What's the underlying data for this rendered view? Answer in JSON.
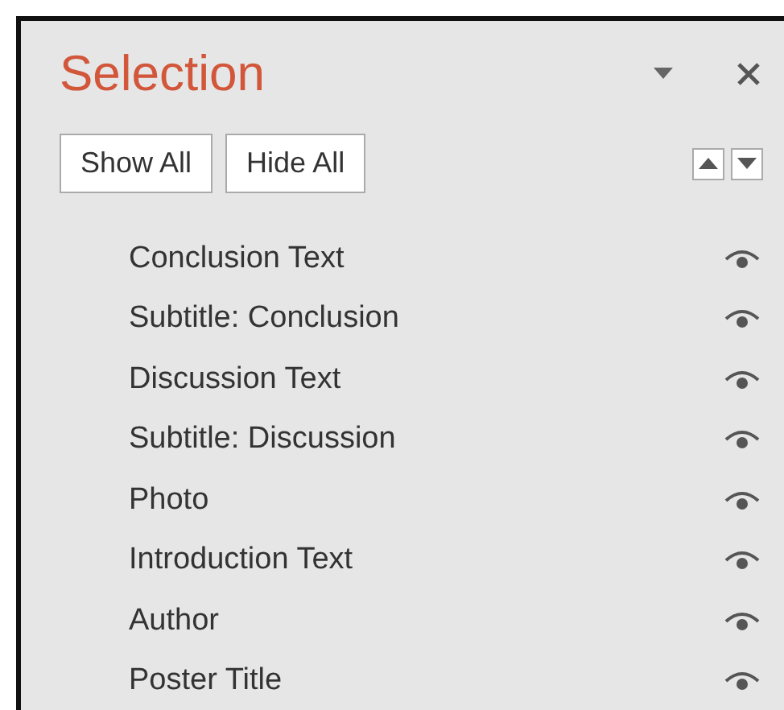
{
  "pane": {
    "title": "Selection"
  },
  "buttons": [
    "Show All",
    "Hide All"
  ],
  "items": [
    {
      "label": "Conclusion Text",
      "visible": true
    },
    {
      "label": "Subtitle: Conclusion",
      "visible": true
    },
    {
      "label": "Discussion Text",
      "visible": true
    },
    {
      "label": "Subtitle: Discussion",
      "visible": true
    },
    {
      "label": "Photo",
      "visible": true
    },
    {
      "label": "Introduction Text",
      "visible": true
    },
    {
      "label": "Author",
      "visible": true
    },
    {
      "label": "Poster Title",
      "visible": true
    }
  ]
}
